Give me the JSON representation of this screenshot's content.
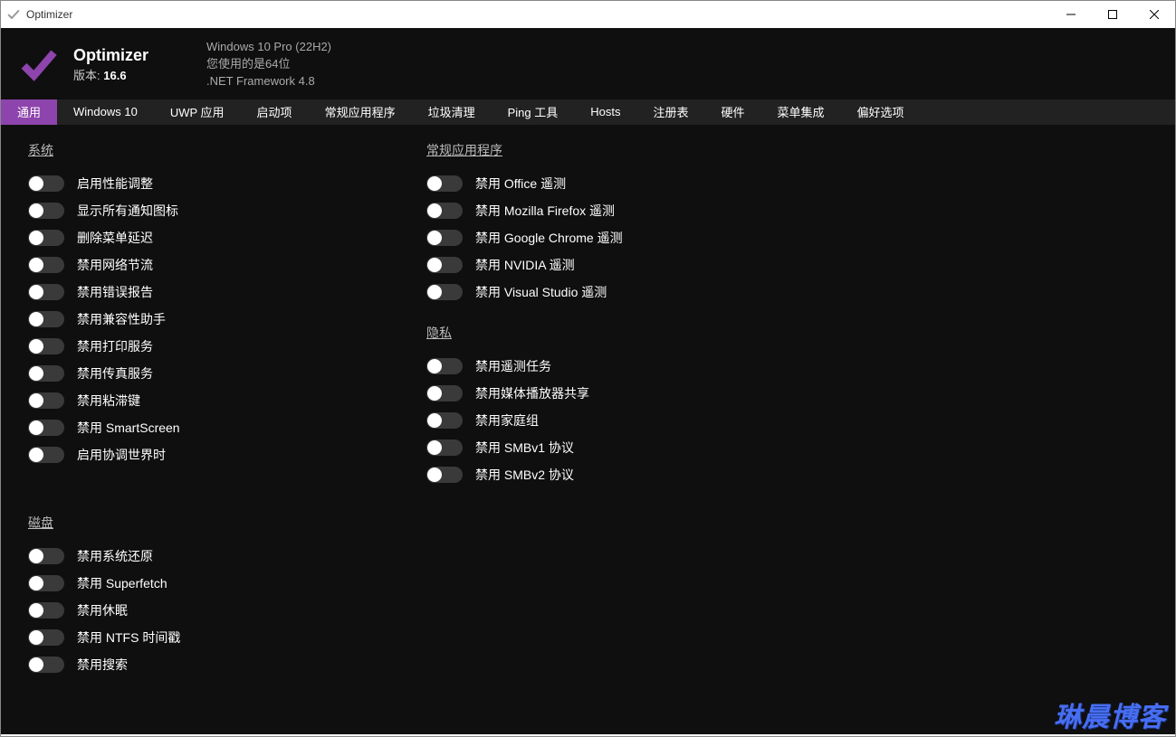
{
  "window": {
    "title": "Optimizer"
  },
  "header": {
    "app_title": "Optimizer",
    "version_label": "版本:",
    "version_value": "16.6",
    "os_line": "Windows 10 Pro (22H2)",
    "arch_line": "您使用的是64位",
    "net_line": ".NET Framework 4.8"
  },
  "tabs": [
    {
      "label": "通用",
      "active": true
    },
    {
      "label": "Windows 10",
      "active": false
    },
    {
      "label": "UWP 应用",
      "active": false
    },
    {
      "label": "启动项",
      "active": false
    },
    {
      "label": "常规应用程序",
      "active": false
    },
    {
      "label": "垃圾清理",
      "active": false
    },
    {
      "label": "Ping 工具",
      "active": false
    },
    {
      "label": "Hosts",
      "active": false
    },
    {
      "label": "注册表",
      "active": false
    },
    {
      "label": "硬件",
      "active": false
    },
    {
      "label": "菜单集成",
      "active": false
    },
    {
      "label": "偏好选项",
      "active": false
    }
  ],
  "sections": {
    "system": {
      "title": "系统",
      "toggles": [
        {
          "label": "启用性能调整",
          "on": false
        },
        {
          "label": "显示所有通知图标",
          "on": false
        },
        {
          "label": "删除菜单延迟",
          "on": false
        },
        {
          "label": "禁用网络节流",
          "on": false
        },
        {
          "label": "禁用错误报告",
          "on": false
        },
        {
          "label": "禁用兼容性助手",
          "on": false
        },
        {
          "label": "禁用打印服务",
          "on": false
        },
        {
          "label": "禁用传真服务",
          "on": false
        },
        {
          "label": "禁用粘滞键",
          "on": false
        },
        {
          "label": "禁用 SmartScreen",
          "on": false
        },
        {
          "label": "启用协调世界时",
          "on": false
        }
      ]
    },
    "disk": {
      "title": "磁盘",
      "toggles": [
        {
          "label": "禁用系统还原",
          "on": false
        },
        {
          "label": "禁用 Superfetch",
          "on": false
        },
        {
          "label": "禁用休眠",
          "on": false
        },
        {
          "label": "禁用 NTFS 时间戳",
          "on": false
        },
        {
          "label": "禁用搜索",
          "on": false
        }
      ]
    },
    "apps": {
      "title": "常规应用程序",
      "toggles": [
        {
          "label": "禁用 Office 遥测",
          "on": false
        },
        {
          "label": "禁用 Mozilla Firefox 遥测",
          "on": false
        },
        {
          "label": "禁用 Google Chrome 遥测",
          "on": false
        },
        {
          "label": "禁用 NVIDIA 遥测",
          "on": false
        },
        {
          "label": "禁用 Visual Studio 遥测",
          "on": false
        }
      ]
    },
    "privacy": {
      "title": "隐私",
      "toggles": [
        {
          "label": "禁用遥测任务",
          "on": false
        },
        {
          "label": "禁用媒体播放器共享",
          "on": false
        },
        {
          "label": "禁用家庭组",
          "on": false
        },
        {
          "label": "禁用 SMBv1 协议",
          "on": false
        },
        {
          "label": "禁用 SMBv2 协议",
          "on": false
        }
      ]
    }
  },
  "watermark": "琳晨博客",
  "colors": {
    "accent": "#8e44ad",
    "toggle_track": "#3a3a3a",
    "bg": "#0f0f0f",
    "tabbar": "#222222"
  }
}
